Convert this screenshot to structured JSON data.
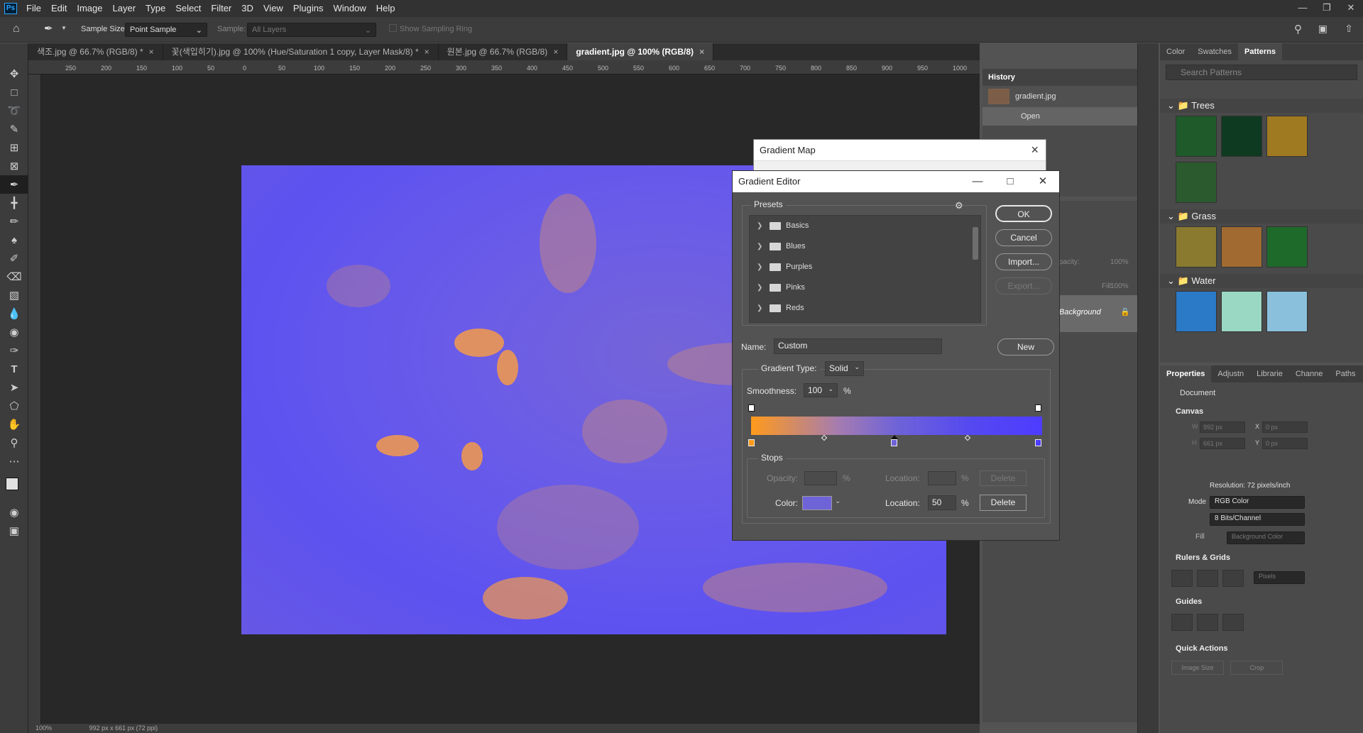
{
  "menu": [
    "File",
    "Edit",
    "Image",
    "Layer",
    "Type",
    "Select",
    "Filter",
    "3D",
    "View",
    "Plugins",
    "Window",
    "Help"
  ],
  "app_badge": "Ps",
  "options": {
    "sample_size_label": "Sample Size:",
    "sample_size_value": "Point Sample",
    "sample_label": "Sample:",
    "sample_value": "All Layers",
    "show_ring": "Show Sampling Ring"
  },
  "tabs": [
    {
      "label": "색조.jpg @ 66.7% (RGB/8) *",
      "active": false
    },
    {
      "label": "꽃(색입히기).jpg @ 100% (Hue/Saturation 1 copy, Layer Mask/8) *",
      "active": false
    },
    {
      "label": "원본.jpg @ 66.7% (RGB/8)",
      "active": false
    },
    {
      "label": "gradient.jpg @ 100% (RGB/8)",
      "active": true
    }
  ],
  "ruler_ticks": [
    "250",
    "200",
    "150",
    "100",
    "50",
    "0",
    "50",
    "100",
    "150",
    "200",
    "250",
    "300",
    "350",
    "400",
    "450",
    "500",
    "550",
    "600",
    "650",
    "700",
    "750",
    "800",
    "850",
    "900",
    "950",
    "1000"
  ],
  "status": {
    "zoom": "100%",
    "doc_info": "992 px x 661 px (72 ppi)"
  },
  "history": {
    "title": "History",
    "snapshot": "gradient.jpg",
    "step": "Open"
  },
  "layers": {
    "opacity_label": "Opacity:",
    "opacity_value": "100%",
    "fill_label": "Fill:",
    "fill_value": "100%",
    "layer_name": "Background"
  },
  "patterns_panel": {
    "tabs": [
      "Color",
      "Swatches",
      "Patterns"
    ],
    "search_placeholder": "Search Patterns",
    "groups": [
      "Trees",
      "Grass",
      "Water"
    ]
  },
  "properties": {
    "tabs": [
      "Properties",
      "Adjustn",
      "Librarie",
      "Channe",
      "Paths"
    ],
    "doc_label": "Document",
    "canvas": "Canvas",
    "w_label": "W",
    "w_value": "992 px",
    "h_label": "H",
    "h_value": "661 px",
    "x_label": "X",
    "x_value": "0 px",
    "y_label": "Y",
    "y_value": "0 px",
    "resolution": "Resolution: 72 pixels/inch",
    "mode_label": "Mode",
    "mode_value": "RGB Color",
    "bits_value": "8 Bits/Channel",
    "fill_label": "Fill",
    "fill_value": "Background Color",
    "rulers_grids": "Rulers & Grids",
    "units": "Pixels",
    "guides": "Guides",
    "quick_actions": "Quick Actions",
    "image_size": "Image Size",
    "crop": "Crop"
  },
  "gradient_map": {
    "title": "Gradient Map"
  },
  "gradient_editor": {
    "title": "Gradient Editor",
    "presets_label": "Presets",
    "presets": [
      "Basics",
      "Blues",
      "Purples",
      "Pinks",
      "Reds"
    ],
    "ok": "OK",
    "cancel": "Cancel",
    "import": "Import...",
    "export": "Export...",
    "name_label": "Name:",
    "name_value": "Custom",
    "new_button": "New",
    "gradient_type_label": "Gradient Type:",
    "gradient_type_value": "Solid",
    "smoothness_label": "Smoothness:",
    "smoothness_value": "100",
    "percent": "%",
    "stops_label": "Stops",
    "opacity_label": "Opacity:",
    "location_label": "Location:",
    "delete": "Delete",
    "color_label": "Color:",
    "location_value": "50",
    "stop_color": "#6f63d8",
    "gradient_start_color": "#ff9a1c",
    "gradient_end_color": "#4e3cff"
  }
}
